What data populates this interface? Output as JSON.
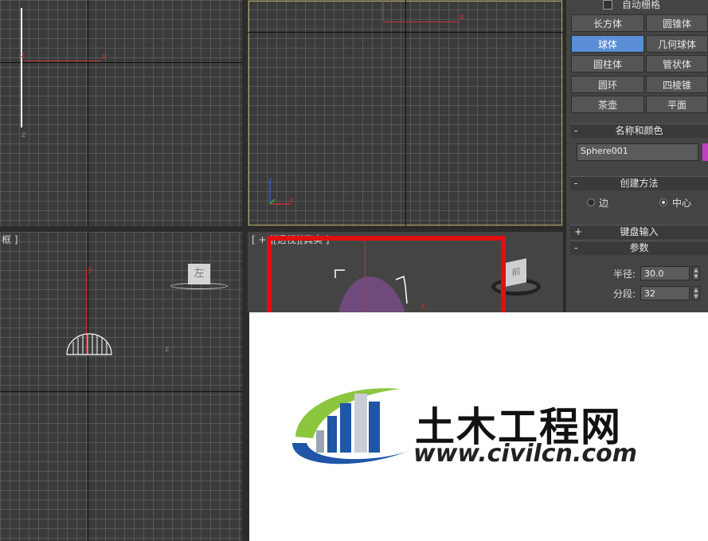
{
  "viewports": {
    "bottom_left_label": "框 ]",
    "perspective_label": "[ + ][透视][真实 ]",
    "front_nav_cube_text": "左",
    "persp_nav_cube_text": "前",
    "axis_x": "x",
    "axis_y": "y",
    "axis_z": "z"
  },
  "panel": {
    "auto_grid": "自动栅格",
    "buttons": [
      {
        "label": "长方体",
        "selected": false
      },
      {
        "label": "圆锥体",
        "selected": false
      },
      {
        "label": "球体",
        "selected": true
      },
      {
        "label": "几何球体",
        "selected": false
      },
      {
        "label": "圆柱体",
        "selected": false
      },
      {
        "label": "管状体",
        "selected": false
      },
      {
        "label": "圆环",
        "selected": false
      },
      {
        "label": "四棱锥",
        "selected": false
      },
      {
        "label": "茶壶",
        "selected": false
      },
      {
        "label": "平面",
        "selected": false
      }
    ],
    "name_color": {
      "sign": "-",
      "title": "名称和颜色",
      "name_value": "Sphere001",
      "swatch_color": "#c040c0"
    },
    "creation_method": {
      "sign": "-",
      "title": "创建方法",
      "opt_edge": "边",
      "opt_center": "中心",
      "selected": "中心"
    },
    "keyboard_entry": {
      "sign": "+",
      "title": "键盘输入"
    },
    "parameters": {
      "sign": "-",
      "title": "参数",
      "radius_label": "半径:",
      "radius_value": "30.0",
      "segments_label": "分段:",
      "segments_value": "32"
    }
  },
  "highlight_color": "#e01010",
  "watermark": {
    "brand": "土木工程网",
    "url": "www.civilcn.com",
    "blue": "#1f56a8",
    "green": "#8cc63f"
  }
}
